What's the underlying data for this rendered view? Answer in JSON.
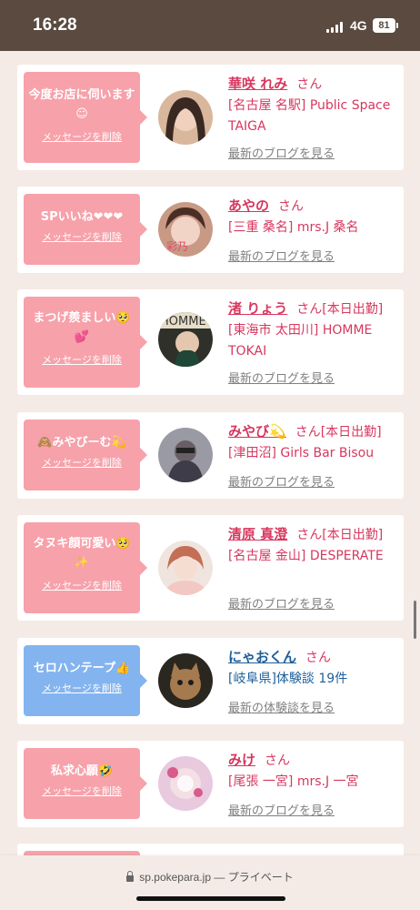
{
  "status": {
    "time": "16:28",
    "network": "4G",
    "battery": "81"
  },
  "browser": {
    "url": "sp.pokepara.jp",
    "mode": "— プライベート"
  },
  "cards": [
    {
      "message": "今度お店に伺います☺",
      "delete_label": "メッセージを削除",
      "name": "華咲 れみ",
      "honorific": "さん",
      "tag": "",
      "shop": "[名古屋 名駅] Public Space TAIGA",
      "link": "最新のブログを見る"
    },
    {
      "message": "SPいいね❤❤❤",
      "delete_label": "メッセージを削除",
      "name": "あやの",
      "honorific": "さん",
      "tag": "",
      "shop": "[三重 桑名] mrs.J 桑名",
      "link": "最新のブログを見る"
    },
    {
      "message": "まつげ羨ましい🥺💕",
      "delete_label": "メッセージを削除",
      "name": "渚 りょう",
      "honorific": "さん",
      "tag": "[本日出勤]",
      "shop": "[東海市 太田川] HOMME TOKAI",
      "link": "最新のブログを見る"
    },
    {
      "message": "🙈みやびーむ💫",
      "delete_label": "メッセージを削除",
      "name": "みやび💫",
      "honorific": "さん",
      "tag": "[本日出勤]",
      "shop": "[津田沼] Girls Bar Bisou",
      "link": "最新のブログを見る"
    },
    {
      "message": "タヌキ顔可愛い🥺✨",
      "delete_label": "メッセージを削除",
      "name": "清原 真澄",
      "honorific": "さん",
      "tag": "[本日出勤]",
      "shop": "[名古屋 金山] DESPERATE",
      "link": "最新のブログを見る"
    },
    {
      "message": "セロハンテープ👍",
      "delete_label": "メッセージを削除",
      "name": "にゃおくん",
      "honorific": "さん",
      "tag": "",
      "shop": "[岐阜県]体験談 19件",
      "link": "最新の体験談を見る"
    },
    {
      "message": "私求心願🤣",
      "delete_label": "メッセージを削除",
      "name": "みけ",
      "honorific": "さん",
      "tag": "",
      "shop": "[尾張 一宮] mrs.J 一宮",
      "link": "最新のブログを見る"
    }
  ]
}
